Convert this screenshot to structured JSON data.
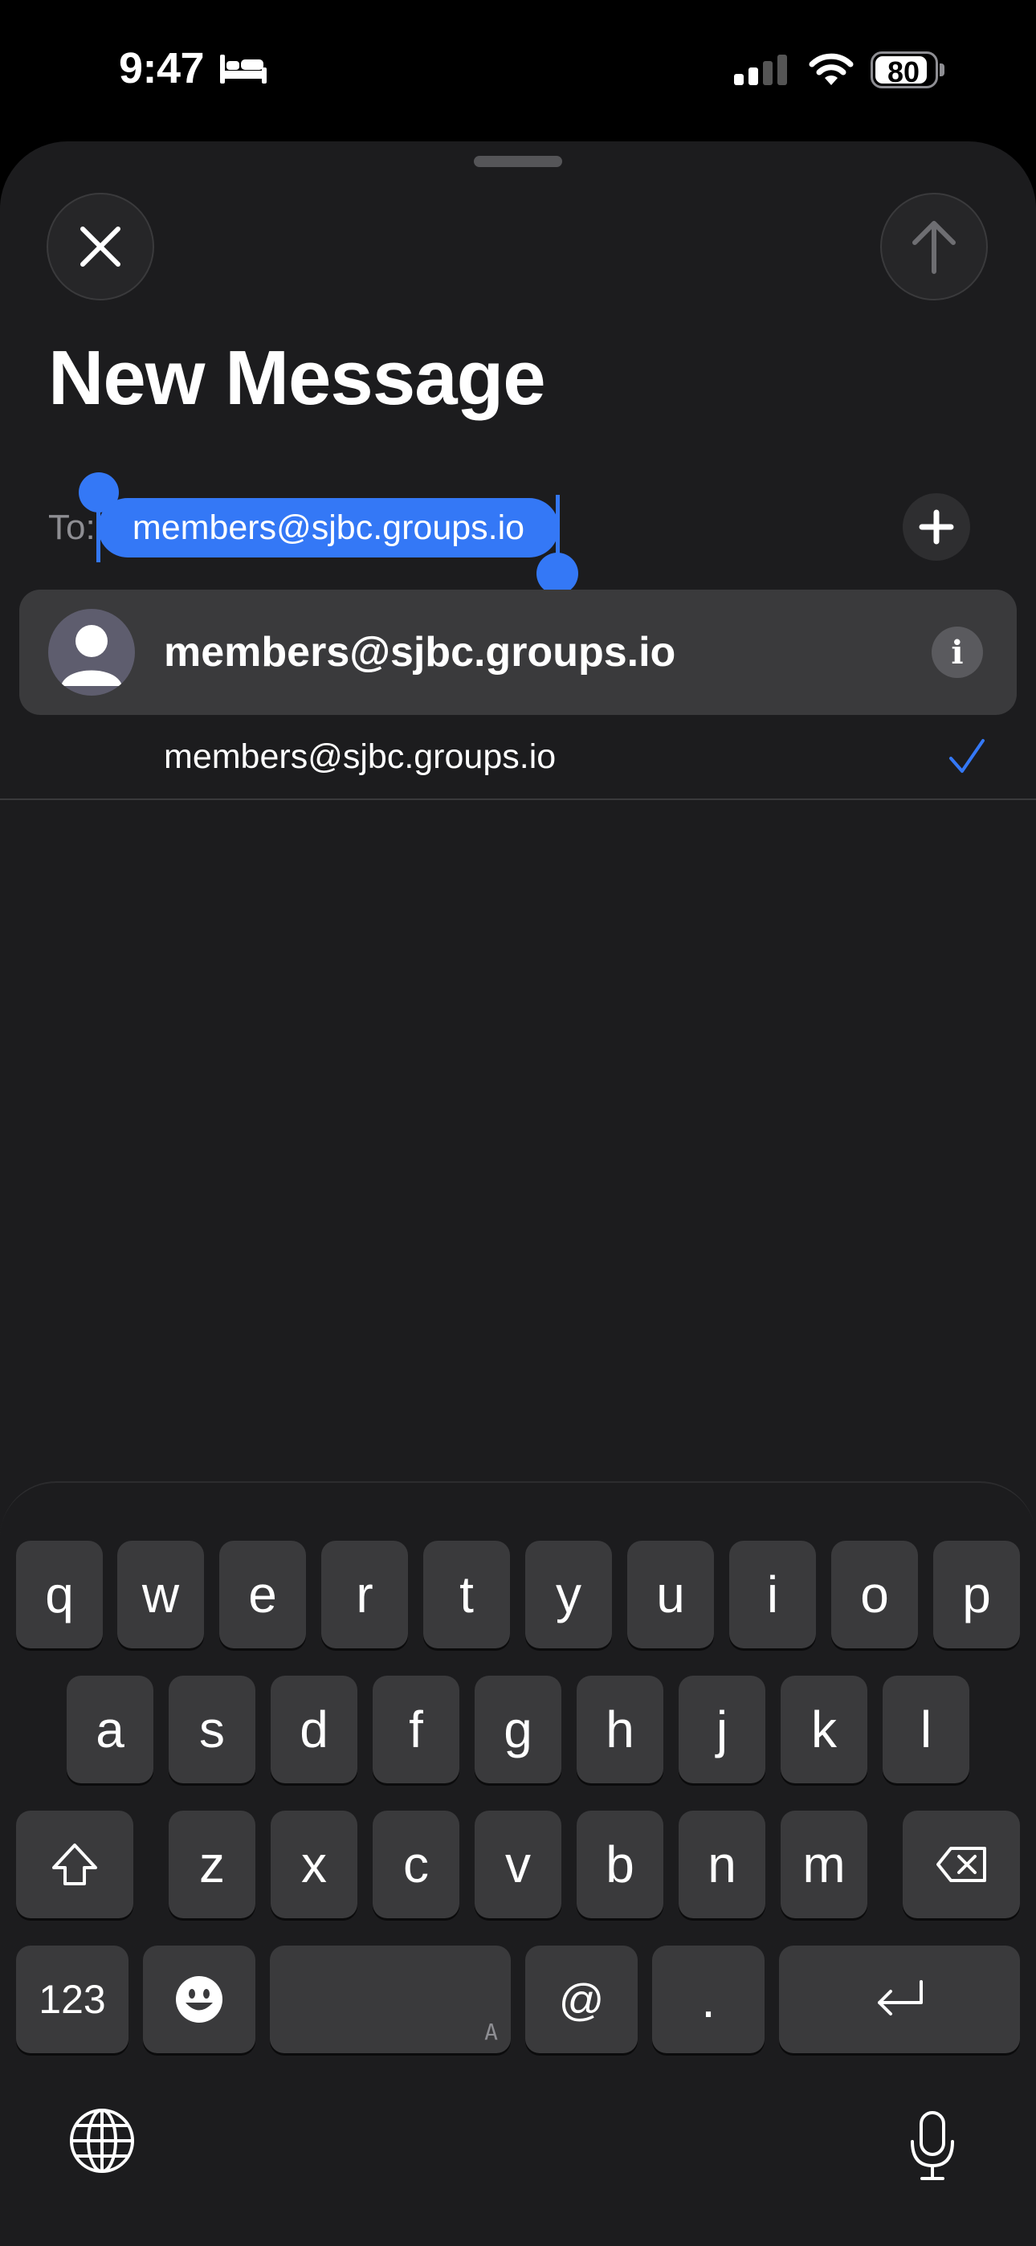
{
  "status_bar": {
    "time": "9:47",
    "battery": "80",
    "icons": [
      "sleep-icon",
      "signal-icon",
      "wifi-icon",
      "battery-icon"
    ]
  },
  "compose": {
    "title": "New Message",
    "to_label": "To:",
    "recipient_token": "members@sjbc.groups.io",
    "close_icon": "close-icon",
    "send_icon": "arrow-up-icon",
    "add_icon": "plus-icon"
  },
  "suggestion": {
    "name": "members@sjbc.groups.io",
    "address": "members@sjbc.groups.io",
    "info_label": "i"
  },
  "keyboard": {
    "row1": [
      "q",
      "w",
      "e",
      "r",
      "t",
      "y",
      "u",
      "i",
      "o",
      "p"
    ],
    "row2": [
      "a",
      "s",
      "d",
      "f",
      "g",
      "h",
      "j",
      "k",
      "l"
    ],
    "row3": [
      "z",
      "x",
      "c",
      "v",
      "b",
      "n",
      "m"
    ],
    "numbers_label": "123",
    "space_hint": "A",
    "at_label": "@",
    "period_label": ".",
    "icons": [
      "shift-icon",
      "backspace-icon",
      "emoji-icon",
      "return-icon",
      "globe-icon",
      "microphone-icon"
    ]
  },
  "colors": {
    "accent": "#3478f6",
    "sheet_background": "#1c1c1e",
    "key_background": "#3a3a3c"
  }
}
